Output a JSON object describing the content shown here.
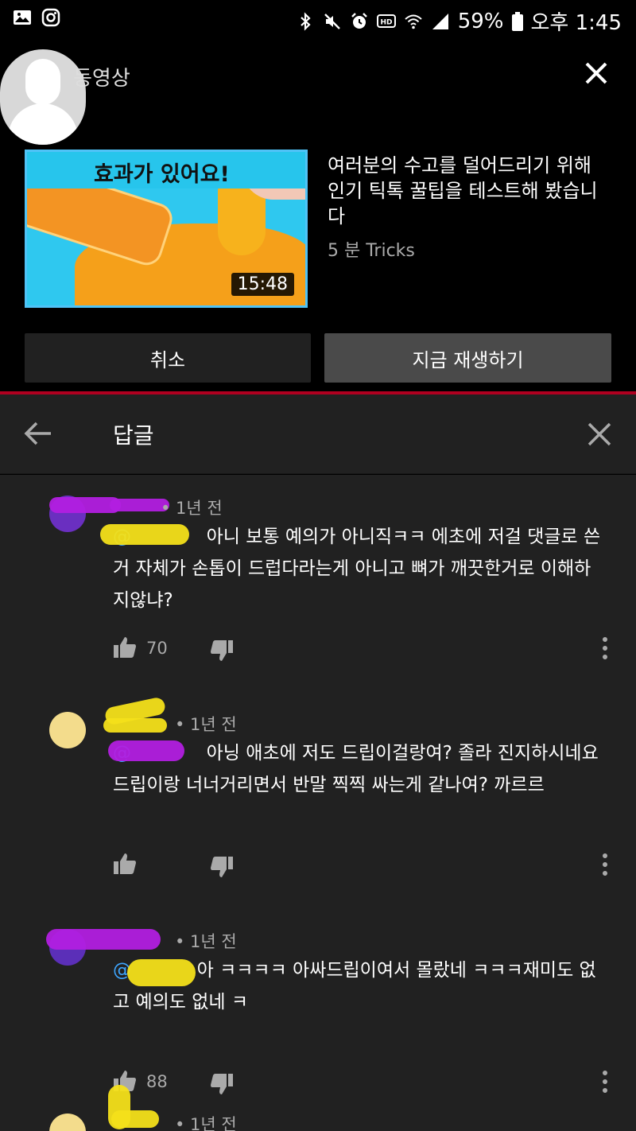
{
  "status_bar": {
    "battery": "59%",
    "time": "오후 1:45",
    "icons": [
      "gallery-icon",
      "instagram-icon",
      "bluetooth-icon",
      "mute-icon",
      "alarm-icon",
      "hd-icon",
      "wifi-icon",
      "signal-icon",
      "battery-icon"
    ]
  },
  "autoplay": {
    "label": "동영상",
    "thumbnail_text": "효과가 있어요!",
    "duration": "15:48",
    "title": "여러분의 수고를 덜어드리기 위해 인기 틱톡 꿀팁을 테스트해 봤습니다",
    "meta": "5 분 Tricks",
    "cancel_label": "취소",
    "play_label": "지금 재생하기"
  },
  "replies": {
    "title": "답글",
    "comments": [
      {
        "time": "• 1년 전",
        "mention": "@",
        "text": "아니 보통 예의가 아니직ㅋㅋ 에초에 저걸 댓글로 쓴거 자체가 손톱이 드럽다라는게 아니고 뼈가 깨끗한거로 이해하지않냐?",
        "likes": "70",
        "avatar_color": "#6a2fc0"
      },
      {
        "time": "• 1년 전",
        "mention": "@",
        "text": "아닝 애초에 저도 드립이걸랑여? 졸라 진지하시네요 드립이랑 너너거리면서 반말 찍찍 싸는게 같나여? 까르르",
        "likes": "",
        "avatar_color": "#f3dc8c"
      },
      {
        "time": "• 1년 전",
        "mention": "@",
        "text": "아 ㅋㅋㅋㅋ 아싸드립이여서 몰랐네 ㅋㅋㅋ재미도 없고 예의도 없네 ㅋ",
        "likes": "88",
        "avatar_color": "#5b2fb8"
      },
      {
        "time": "• 1년 전",
        "mention": "",
        "text": "",
        "likes": "",
        "avatar_color": "#f3dc8c"
      }
    ]
  },
  "colors": {
    "background": "#212121",
    "mention": "#3ea6ff",
    "accent_line": "#b00020",
    "scribble_yellow": "#f4e01a",
    "scribble_purple": "#b21fe0"
  }
}
